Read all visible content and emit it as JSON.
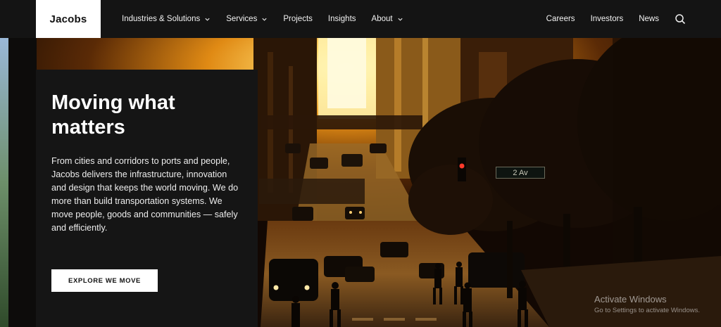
{
  "brand": {
    "logo_text": "Jacobs"
  },
  "nav": {
    "left": [
      {
        "label": "Industries & Solutions",
        "has_dropdown": true
      },
      {
        "label": "Services",
        "has_dropdown": true
      },
      {
        "label": "Projects",
        "has_dropdown": false
      },
      {
        "label": "Insights",
        "has_dropdown": false
      },
      {
        "label": "About",
        "has_dropdown": true
      }
    ],
    "right": [
      {
        "label": "Careers"
      },
      {
        "label": "Investors"
      },
      {
        "label": "News"
      }
    ],
    "search_icon": "search-icon"
  },
  "hero": {
    "headline": "Moving what matters",
    "body": "From cities and corridors to ports and people, Jacobs delivers the infrastructure, innovation and design that keeps the world moving. We do more than build transportation systems. We move people, goods and communities — safely and efficiently.",
    "cta_label": "EXPLORE WE MOVE",
    "street_sign": "2 Av"
  },
  "os_watermark": {
    "title": "Activate Windows",
    "subtitle": "Go to Settings to activate Windows."
  },
  "colors": {
    "header_bg": "#141414",
    "panel_bg": "#151515",
    "sun": "#ffd86a",
    "glow": "#f0a020"
  }
}
